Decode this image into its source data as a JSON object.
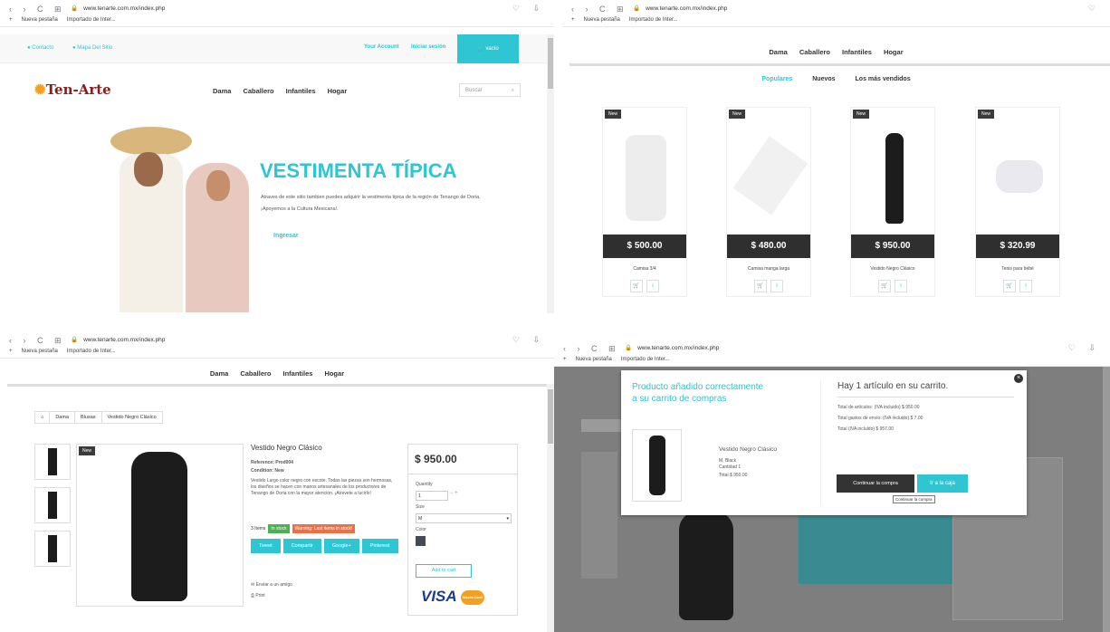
{
  "browser": {
    "url_tl": "www.tenarte.com.mx/index.php",
    "url_tr": "www.tenarte.com.mx/index.php",
    "url_bl": "www.tenarte.com.mx/index.php",
    "url_br": "www.tenarte.com.mx/index.php",
    "bookmark_1": "Nueva pestaña",
    "bookmark_2": "Importado de Inter..."
  },
  "home": {
    "contact": "Contacto",
    "sitemap": "Mapa Del Sitio",
    "your_account": "Your Account",
    "login": "Iniciar sesión",
    "cart": "vacío",
    "logo": "Ten-Arte",
    "search_placeholder": "Buscar",
    "hero_title": "VESTIMENTA TÍPICA",
    "hero_text": "Atraves de este sitio tambien puedes adquirir la vestimenta tipica de la región de Tenango de Doria, ¡Apoyemos a la Cultura Mexicana!.",
    "hero_cta": "Ingresar"
  },
  "nav": {
    "items": [
      "Dama",
      "Caballero",
      "Infantiles",
      "Hogar"
    ]
  },
  "listing": {
    "tabs": [
      "Populares",
      "Nuevos",
      "Los más vendidos"
    ],
    "badge": "New",
    "products": [
      {
        "price": "$ 500.00",
        "name": "Camisa 3/4"
      },
      {
        "price": "$ 480.00",
        "name": "Camisa manga larga"
      },
      {
        "price": "$ 950.00",
        "name": "Vestido Negro Clásico"
      },
      {
        "price": "$ 320.99",
        "name": "Tenis para bebé"
      }
    ]
  },
  "product": {
    "breadcrumb": [
      "Dama",
      "Blusas",
      "Vestido Negro Clásico"
    ],
    "badge": "New",
    "title": "Vestido Negro Clásico",
    "reference": "Reference: Prod004",
    "condition": "Condition: New",
    "description": "Vestido Largo color negro con escote. Todas las piezas son hermosas, los diseños se hacen con manos artesanales de los productores de Tenango de Doria con la mayor atención. ¡Atrevete a lucirlo!",
    "items": "3 Items",
    "stock": "In stock",
    "warning": "Warning: Last items in stock!",
    "social": [
      "Tweet",
      "Compartir",
      "Google+",
      "Pinterest"
    ],
    "send": "Enviar a un amigo",
    "print": "Print",
    "price": "$ 950.00",
    "quantity_label": "Quantity",
    "quantity": "1",
    "size_label": "Size",
    "size": "M",
    "color_label": "Color",
    "add": "Add to cart",
    "visa": "VISA",
    "mastercard": "MasterCard"
  },
  "modal": {
    "success": "Producto añadido correctamente a su carrito de compras",
    "product_name": "Vestido Negro Clásico",
    "variant": "M, Black",
    "qty": "Cantidad 1",
    "total": "Total $ 950.00",
    "heading": "Hay 1 artículo en su carrito.",
    "total_items": "Total de artículos: (IVA incluido) $ 950.00",
    "shipping": "Total gastos de envío: (IVA incluido) $ 7.00",
    "grand_total": "Total (IVA incluido) $ 957.00",
    "continue": "Continuar la compra",
    "checkout": "Ir a la caja",
    "tooltip": "Continuar la compra",
    "close": "×"
  },
  "colors": {
    "accent": "#2ec6d2",
    "dark": "#2f2f2f",
    "stock": "#4bb04f",
    "warning": "#f06e44"
  }
}
